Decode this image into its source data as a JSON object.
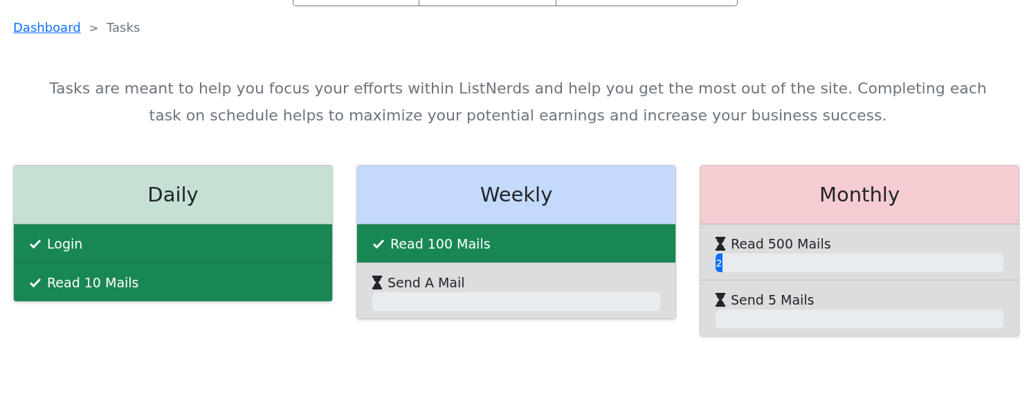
{
  "breadcrumb": {
    "link": "Dashboard",
    "separator": ">",
    "current": "Tasks"
  },
  "intro": "Tasks are meant to help you focus your efforts within ListNerds and help you get the most out of the site. Completing each task on schedule helps to maximize your potential earnings and increase your business success.",
  "cards": [
    {
      "title": "Daily",
      "color": "#c6e0d4",
      "tasks": [
        {
          "label": "Login",
          "completed": true
        },
        {
          "label": "Read 10 Mails",
          "completed": true
        }
      ]
    },
    {
      "title": "Weekly",
      "color": "#c4dafd",
      "tasks": [
        {
          "label": "Read 100 Mails",
          "completed": true
        },
        {
          "label": "Send A Mail",
          "completed": false
        }
      ]
    },
    {
      "title": "Monthly",
      "color": "#f5ccd2",
      "tasks": [
        {
          "label": "Read 500 Mails",
          "completed": false,
          "level": 0.004,
          "progress_label": "2"
        },
        {
          "label": "Send 5 Mails",
          "completed": false
        }
      ]
    }
  ]
}
